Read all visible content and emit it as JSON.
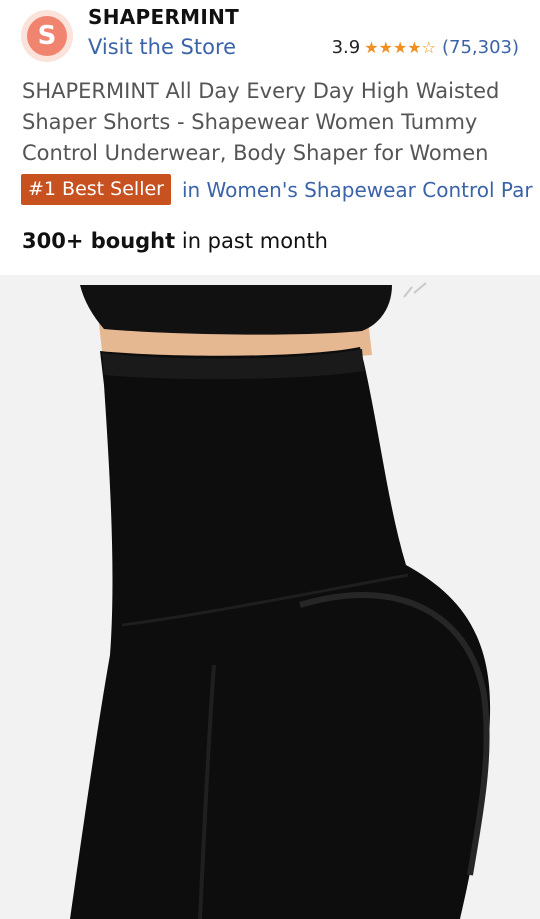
{
  "brand": {
    "logo_letter": "S",
    "name": "SHAPERMINT",
    "store_link": "Visit the Store"
  },
  "rating": {
    "value": "3.9",
    "stars": 3.9,
    "review_count": "(75,303)",
    "star_color": "#f08f22"
  },
  "product": {
    "title": "SHAPERMINT All Day Every Day High Waisted Shaper Shorts - Shapewear Women Tummy Control Underwear, Body Shaper for Women"
  },
  "badge": {
    "label": "#1 Best Seller",
    "category_link": "in Women's Shapewear Control Par"
  },
  "social_proof": {
    "count": "300+ bought",
    "suffix": " in past month"
  },
  "image": {
    "subject": "product-photo-black-high-waisted-shaper"
  },
  "colors": {
    "link": "#3b63a8",
    "badge_bg": "#c7511f",
    "logo_bg": "#f0846f",
    "image_bg": "#f2f2f2"
  }
}
